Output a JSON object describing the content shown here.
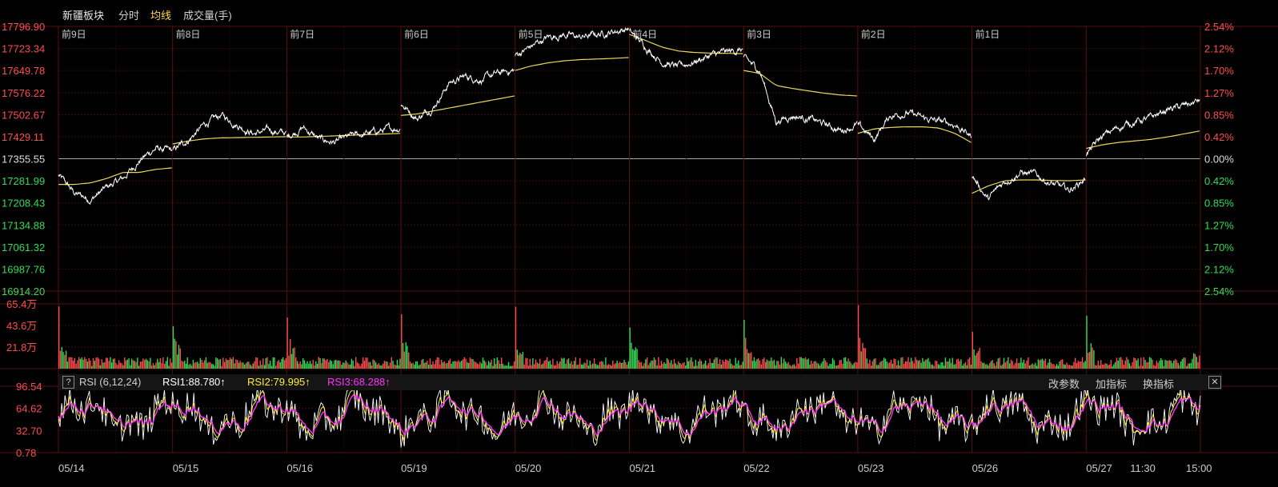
{
  "header": {
    "title": "新疆板块",
    "tab_intraday": "分时",
    "tab_avg": "均线",
    "tab_volume": "成交量(手)"
  },
  "colors": {
    "up": "#ff4d4d",
    "down": "#33dd55",
    "price_line": "#ffffff",
    "avg_line": "#e8d85a",
    "rsi1": "#ffffff",
    "rsi2": "#ffee33",
    "rsi3": "#ff33ff",
    "grid": "#3a0000"
  },
  "price_axis": {
    "left_ticks": [
      "17796.90",
      "17723.34",
      "17649.78",
      "17576.22",
      "17502.67",
      "17429.11",
      "17355.55",
      "17281.99",
      "17208.43",
      "17134.88",
      "17061.32",
      "16987.76",
      "16914.20"
    ],
    "right_ticks": [
      "2.54%",
      "2.12%",
      "1.70%",
      "1.27%",
      "0.85%",
      "0.42%",
      "0.00%",
      "0.42%",
      "0.85%",
      "1.27%",
      "1.70%",
      "2.12%",
      "2.54%"
    ],
    "base_price": 17355.55
  },
  "day_labels": [
    "前9日",
    "前8日",
    "前7日",
    "前6日",
    "前5日",
    "前4日",
    "前3日",
    "前2日",
    "前1日"
  ],
  "volume_axis": {
    "ticks": [
      "65.4万",
      "43.6万",
      "21.8万"
    ]
  },
  "rsi_panel": {
    "help_label": "?",
    "name": "RSI (6,12,24)",
    "rsi1": "RSI1:88.780↑",
    "rsi2": "RSI2:79.995↑",
    "rsi3": "RSI3:68.288↑",
    "btn_change_params": "改参数",
    "btn_add_indicator": "加指标",
    "btn_switch_indicator": "换指标",
    "btn_close": "✕",
    "ticks": [
      "96.54",
      "64.62",
      "32.70",
      "0.78"
    ]
  },
  "x_axis": {
    "dates": [
      "05/14",
      "05/15",
      "05/16",
      "05/19",
      "05/20",
      "05/21",
      "05/22",
      "05/23",
      "05/26",
      "05/27"
    ],
    "time_mid": "11:30",
    "time_end": "15:00"
  },
  "chart_data": {
    "type": "line",
    "title": "新疆板块",
    "ylim": [
      16914.2,
      17796.9
    ],
    "days": [
      "05/14",
      "05/15",
      "05/16",
      "05/19",
      "05/20",
      "05/21",
      "05/22",
      "05/23",
      "05/26",
      "05/27"
    ],
    "series": [
      {
        "name": "分时",
        "keypoints": [
          [
            17300,
            17240,
            17220,
            17260,
            17290,
            17350,
            17390,
            17380
          ],
          [
            17380,
            17420,
            17470,
            17500,
            17470,
            17440,
            17450,
            17440
          ],
          [
            17430,
            17460,
            17420,
            17410,
            17430,
            17440,
            17450,
            17460
          ],
          [
            17540,
            17490,
            17530,
            17610,
            17630,
            17620,
            17640,
            17650
          ],
          [
            17700,
            17730,
            17760,
            17770,
            17760,
            17770,
            17780,
            17790
          ],
          [
            17780,
            17730,
            17680,
            17660,
            17680,
            17700,
            17710,
            17720
          ],
          [
            17690,
            17650,
            17480,
            17500,
            17490,
            17470,
            17450,
            17470
          ],
          [
            17470,
            17420,
            17500,
            17510,
            17490,
            17480,
            17470,
            17430
          ],
          [
            17300,
            17220,
            17280,
            17310,
            17300,
            17270,
            17250,
            17290
          ],
          [
            17370,
            17430,
            17460,
            17480,
            17490,
            17520,
            17530,
            17550
          ]
        ]
      },
      {
        "name": "均线",
        "keypoints": [
          [
            17270,
            17270,
            17275,
            17290,
            17310,
            17310,
            17320,
            17325
          ],
          [
            17405,
            17415,
            17422,
            17425,
            17426,
            17427,
            17428,
            17429
          ],
          [
            17428,
            17428,
            17430,
            17432,
            17434,
            17436,
            17438,
            17440
          ],
          [
            17500,
            17505,
            17515,
            17525,
            17535,
            17545,
            17555,
            17565
          ],
          [
            17650,
            17665,
            17675,
            17682,
            17686,
            17688,
            17690,
            17693
          ],
          [
            17770,
            17750,
            17728,
            17715,
            17710,
            17708,
            17707,
            17706
          ],
          [
            17650,
            17640,
            17600,
            17590,
            17582,
            17574,
            17568,
            17565
          ],
          [
            17440,
            17455,
            17460,
            17462,
            17462,
            17458,
            17440,
            17410
          ],
          [
            17240,
            17265,
            17282,
            17285,
            17285,
            17283,
            17282,
            17285
          ],
          [
            17390,
            17402,
            17410,
            17415,
            17420,
            17428,
            17438,
            17448
          ]
        ]
      }
    ],
    "volume_max": 654000,
    "rsi_ylim": [
      0.78,
      96.54
    ]
  }
}
